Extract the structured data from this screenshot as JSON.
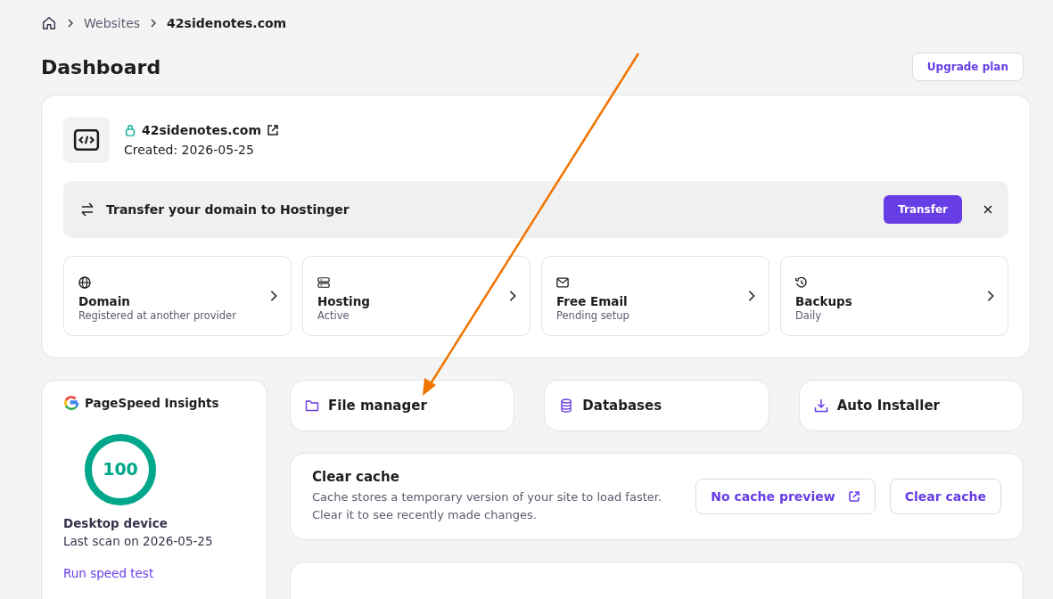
{
  "breadcrumb": [
    "Websites",
    "42sidenotes.com"
  ],
  "title": "Dashboard",
  "upgrade_button": "Upgrade plan",
  "site": {
    "domain": "42sidenotes.com",
    "created": "Created: 2026-05-25"
  },
  "transfer_banner": {
    "text": "Transfer your domain to Hostinger",
    "button": "Transfer"
  },
  "quick_links": [
    {
      "kind": "globe",
      "title": "Domain",
      "status": "Registered at another provider"
    },
    {
      "kind": "server",
      "title": "Hosting",
      "status": "Active"
    },
    {
      "kind": "mail",
      "title": "Free Email",
      "status": "Pending setup"
    },
    {
      "kind": "history",
      "title": "Backups",
      "status": "Daily"
    }
  ],
  "pagespeed": {
    "title": "PageSpeed Insights",
    "score": "100",
    "level": 1,
    "device": "Desktop device",
    "last_scan": "Last scan on 2026-05-25",
    "link": "Run speed test"
  },
  "tools": [
    {
      "kind": "folder",
      "label": "File manager"
    },
    {
      "kind": "database",
      "label": "Databases"
    },
    {
      "kind": "download",
      "label": "Auto Installer"
    }
  ],
  "clear_cache": {
    "title": "Clear cache",
    "description": "Cache stores a temporary version of your site to load faster. Clear it to see recently made changes.",
    "preview_button": "No cache preview",
    "clear_button": "Clear cache"
  }
}
